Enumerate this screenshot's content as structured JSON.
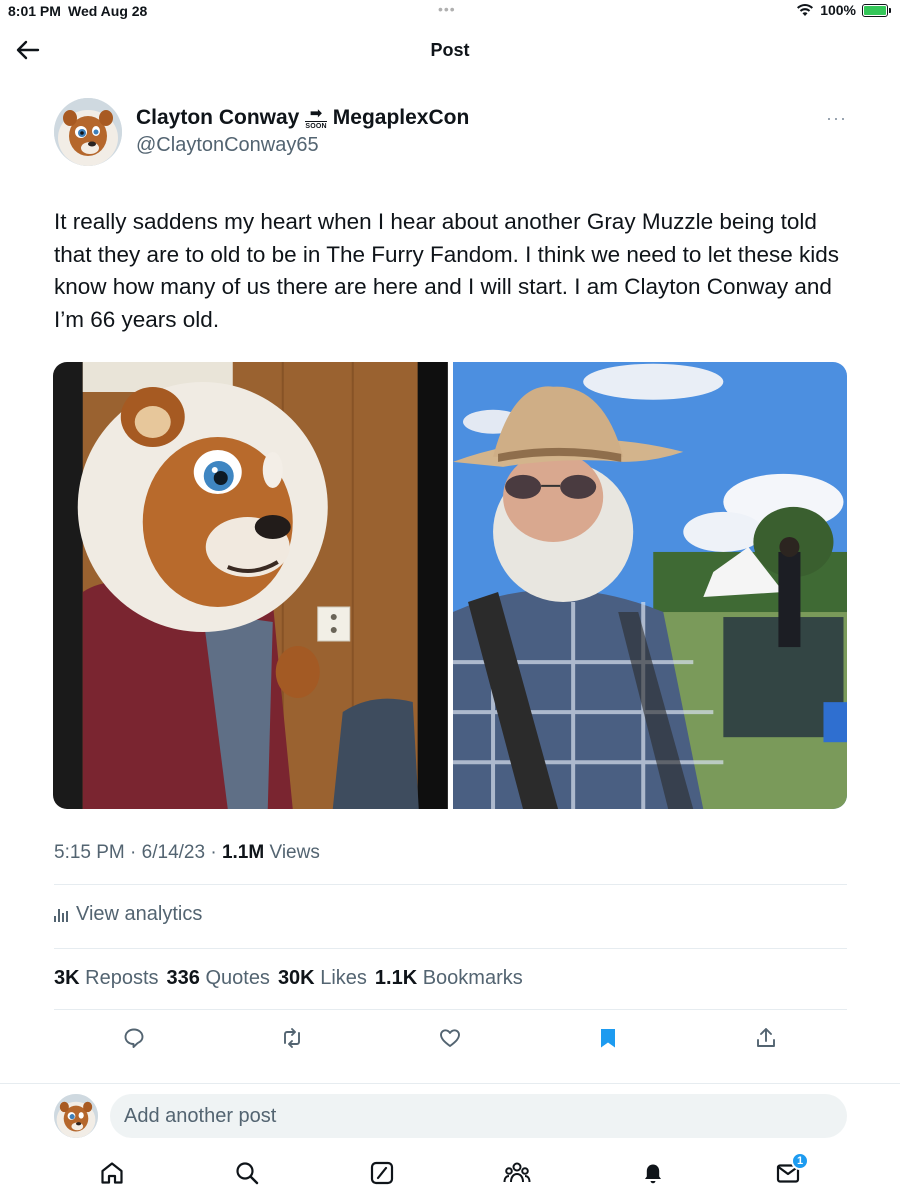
{
  "status_bar": {
    "time": "8:01 PM",
    "date": "Wed Aug 28",
    "battery": "100%",
    "battery_level": 1.0,
    "dots": "•••"
  },
  "header": {
    "title": "Post",
    "back_icon": "arrow-left-icon"
  },
  "author": {
    "name": "Clayton Conway",
    "name_suffix": "MegaplexCon",
    "soon_label": "SOON",
    "handle": "@ClaytonConway65",
    "more_icon": "ellipsis-icon",
    "more_label": "···"
  },
  "post": {
    "text": "It really saddens my heart when I hear about another Gray Muzzle being told that they are to old to be in The Furry Fandom. I think we need to let these kids know how many of us there are here and I will start. I am Clayton Conway and I’m 66 years old.",
    "media": [
      {
        "description_icon": "fursuit-photo"
      },
      {
        "description_icon": "cowboy-photo"
      }
    ],
    "time": "5:15 PM",
    "separator": "·",
    "date": "6/14/23",
    "views_count": "1.1M",
    "views_label": "Views"
  },
  "analytics": {
    "label": "View analytics",
    "icon": "bar-chart-icon"
  },
  "stats": {
    "reposts_count": "3K",
    "reposts_label": "Reposts",
    "quotes_count": "336",
    "quotes_label": "Quotes",
    "likes_count": "30K",
    "likes_label": "Likes",
    "bookmarks_count": "1.1K",
    "bookmarks_label": "Bookmarks"
  },
  "actions": {
    "reply_icon": "reply-icon",
    "repost_icon": "repost-icon",
    "like_icon": "heart-icon",
    "bookmark_icon": "bookmark-icon",
    "share_icon": "share-icon"
  },
  "reply": {
    "placeholder": "Add another post"
  },
  "tab_bar": {
    "items": [
      "home-icon",
      "search-icon",
      "grok-icon",
      "communities-icon",
      "notifications-icon",
      "messages-icon"
    ],
    "messages_badge": "1"
  },
  "colors": {
    "text": "#0f1419",
    "secondary": "#536471",
    "accent": "#1d9bf0",
    "battery": "#34c759",
    "divider": "#e6ecf0"
  }
}
